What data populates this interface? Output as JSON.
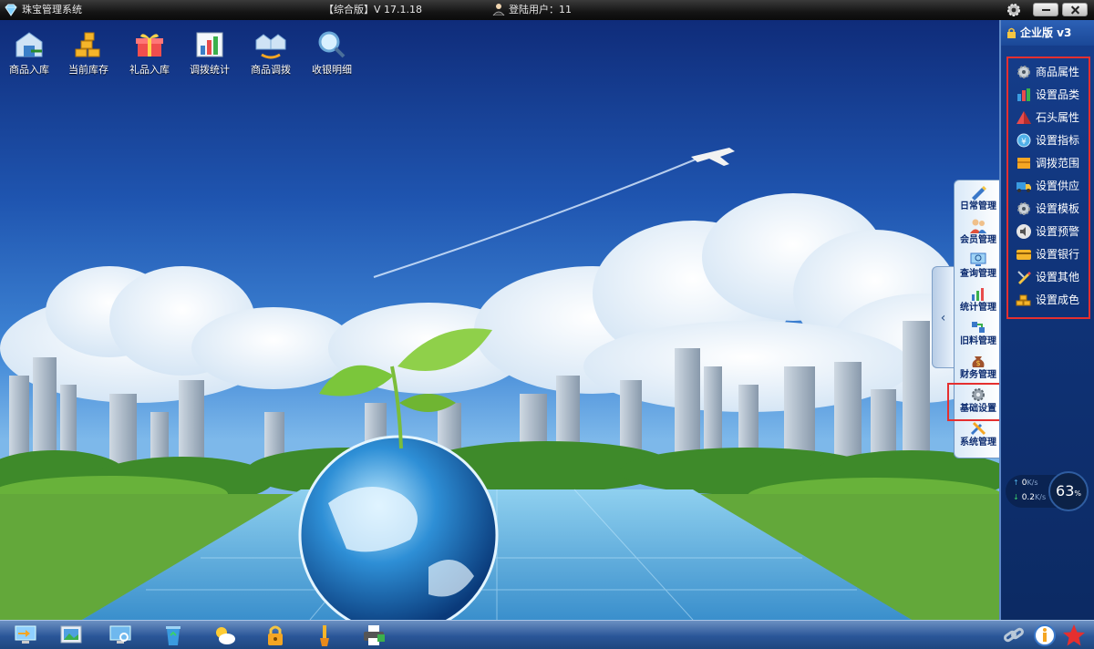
{
  "titlebar": {
    "app_title": "珠宝管理系统",
    "edition": "【综合版】V 17.1.18",
    "user_label": "登陆用户：11"
  },
  "toolbar": [
    {
      "label": "商品入库",
      "icon": "warehouse-in-icon"
    },
    {
      "label": "当前库存",
      "icon": "gold-stack-icon"
    },
    {
      "label": "礼品入库",
      "icon": "gift-icon"
    },
    {
      "label": "调拨统计",
      "icon": "bar-chart-icon"
    },
    {
      "label": "商品调拨",
      "icon": "transfer-icon"
    },
    {
      "label": "收银明细",
      "icon": "magnifier-icon"
    }
  ],
  "vertical_tabs": [
    {
      "label": "日常管理",
      "icon": "pen-icon"
    },
    {
      "label": "会员管理",
      "icon": "members-icon"
    },
    {
      "label": "查询管理",
      "icon": "monitor-search-icon"
    },
    {
      "label": "统计管理",
      "icon": "stats-icon"
    },
    {
      "label": "旧料管理",
      "icon": "recycle-icon"
    },
    {
      "label": "财务管理",
      "icon": "money-bag-icon"
    },
    {
      "label": "基础设置",
      "icon": "gear-icon"
    },
    {
      "label": "系统管理",
      "icon": "tools-icon"
    }
  ],
  "right_panel": {
    "header": "企业版 v3",
    "items": [
      {
        "label": "商品属性",
        "icon": "gear-icon"
      },
      {
        "label": "设置品类",
        "icon": "bar-chart-icon"
      },
      {
        "label": "石头属性",
        "icon": "pyramid-icon"
      },
      {
        "label": "设置指标",
        "icon": "coin-icon"
      },
      {
        "label": "调拨范围",
        "icon": "book-icon"
      },
      {
        "label": "设置供应",
        "icon": "truck-icon"
      },
      {
        "label": "设置模板",
        "icon": "gear-icon"
      },
      {
        "label": "设置预警",
        "icon": "speaker-icon"
      },
      {
        "label": "设置银行",
        "icon": "card-icon"
      },
      {
        "label": "设置其他",
        "icon": "pencil-icon"
      },
      {
        "label": "设置成色",
        "icon": "gold-bars-icon"
      }
    ]
  },
  "network": {
    "upload": "0",
    "upload_unit": "K/s",
    "download": "0.2",
    "download_unit": "K/s",
    "cpu": "63",
    "cpu_unit": "%"
  },
  "taskbar": [
    {
      "icon": "monitor-arrow-icon"
    },
    {
      "icon": "picture-frame-icon"
    },
    {
      "icon": "monitor-search-icon"
    },
    {
      "icon": "recycle-bin-icon"
    },
    {
      "icon": "weather-icon"
    },
    {
      "icon": "lock-icon"
    },
    {
      "icon": "brush-icon"
    },
    {
      "icon": "printer-icon"
    },
    {
      "icon": "link-icon"
    },
    {
      "icon": "info-icon"
    },
    {
      "icon": "star-icon"
    }
  ],
  "colors": {
    "highlight_border": "#e52f2f",
    "panel_bg": "#0f3276",
    "menu_text": "#ffffff"
  }
}
